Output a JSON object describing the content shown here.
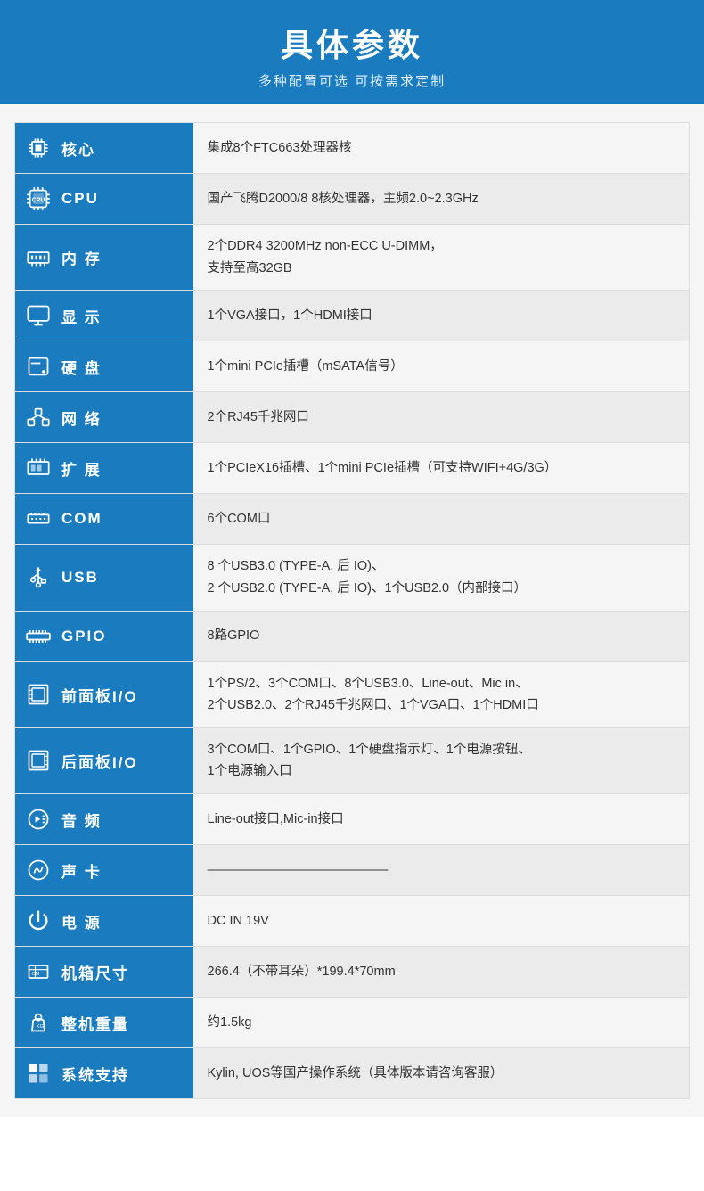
{
  "header": {
    "title": "具体参数",
    "subtitle": "多种配置可选 可按需求定制"
  },
  "rows": [
    {
      "id": "core",
      "icon": "core-icon",
      "label": "核心",
      "value": "集成8个FTC663处理器核"
    },
    {
      "id": "cpu",
      "icon": "cpu-icon",
      "label": "CPU",
      "value": "国产飞腾D2000/8  8核处理器，主频2.0~2.3GHz"
    },
    {
      "id": "memory",
      "icon": "memory-icon",
      "label": "内 存",
      "value": "2个DDR4 3200MHz non-ECC U-DIMM，\n支持至高32GB"
    },
    {
      "id": "display",
      "icon": "display-icon",
      "label": "显 示",
      "value": "1个VGA接口，1个HDMI接口"
    },
    {
      "id": "harddisk",
      "icon": "harddisk-icon",
      "label": "硬 盘",
      "value": "1个mini PCIe插槽（mSATA信号）"
    },
    {
      "id": "network",
      "icon": "network-icon",
      "label": "网 络",
      "value": "2个RJ45千兆网口"
    },
    {
      "id": "expansion",
      "icon": "expansion-icon",
      "label": "扩 展",
      "value": "1个PCIeX16插槽、1个mini PCIe插槽（可支持WIFI+4G/3G）"
    },
    {
      "id": "com",
      "icon": "com-icon",
      "label": "COM",
      "value": "6个COM口"
    },
    {
      "id": "usb",
      "icon": "usb-icon",
      "label": "USB",
      "value": "8 个USB3.0 (TYPE-A, 后 IO)、\n2 个USB2.0 (TYPE-A, 后 IO)、1个USB2.0（内部接口）"
    },
    {
      "id": "gpio",
      "icon": "gpio-icon",
      "label": "GPIO",
      "value": "8路GPIO"
    },
    {
      "id": "front-panel",
      "icon": "front-panel-icon",
      "label": "前面板I/O",
      "value": "1个PS/2、3个COM口、8个USB3.0、Line-out、Mic in、\n2个USB2.0、2个RJ45千兆网口、1个VGA口、1个HDMI口"
    },
    {
      "id": "rear-panel",
      "icon": "rear-panel-icon",
      "label": "后面板I/O",
      "value": "3个COM口、1个GPIO、1个硬盘指示灯、1个电源按钮、\n1个电源输入口"
    },
    {
      "id": "audio",
      "icon": "audio-icon",
      "label": "音 频",
      "value": "Line-out接口,Mic-in接口"
    },
    {
      "id": "soundcard",
      "icon": "soundcard-icon",
      "label": "声 卡",
      "value": "——————————————"
    },
    {
      "id": "power",
      "icon": "power-icon",
      "label": "电 源",
      "value": "DC IN 19V"
    },
    {
      "id": "dimensions",
      "icon": "dimensions-icon",
      "label": "机箱尺寸",
      "value": "266.4（不带耳朵）*199.4*70mm"
    },
    {
      "id": "weight",
      "icon": "weight-icon",
      "label": "整机重量",
      "value": "约1.5kg"
    },
    {
      "id": "os",
      "icon": "os-icon",
      "label": "系统支持",
      "value": "Kylin, UOS等国产操作系统（具体版本请咨询客服）"
    }
  ]
}
